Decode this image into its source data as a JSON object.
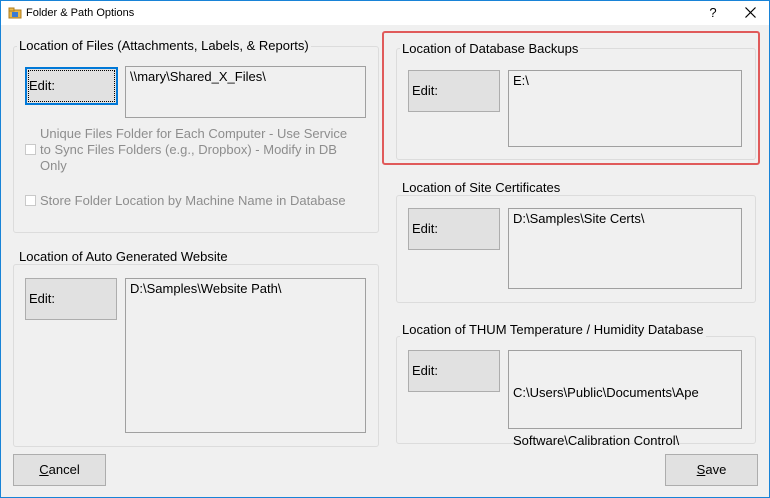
{
  "window": {
    "title": "Folder & Path Options",
    "help_label": "?"
  },
  "files_group": {
    "title": "Location of Files (Attachments, Labels, & Reports)",
    "edit_label": "Edit:",
    "path": "\\\\mary\\Shared_X_Files\\",
    "unique_folder_label_lines": [
      "Unique Files Folder for Each Computer - Use Service",
      "to Sync Files Folders (e.g., Dropbox) - Modify in DB",
      "Only"
    ],
    "store_by_machine_label": "Store Folder Location by Machine Name in Database"
  },
  "website_group": {
    "title": "Location of Auto Generated Website",
    "edit_label": "Edit:",
    "path": "D:\\Samples\\Website Path\\"
  },
  "backups_group": {
    "title": "Location of Database Backups",
    "edit_label": "Edit:",
    "path": "E:\\"
  },
  "certs_group": {
    "title": "Location of Site Certificates",
    "edit_label": "Edit:",
    "path": "D:\\Samples\\Site Certs\\"
  },
  "thum_group": {
    "title": "Location of THUM Temperature / Humidity Database",
    "edit_label": "Edit:",
    "path_lines": [
      "C:\\Users\\Public\\Documents\\Ape",
      "Software\\Calibration Control\\"
    ]
  },
  "footer": {
    "cancel_label": "Cancel",
    "save_label": "Save"
  },
  "colors": {
    "highlight": "#e05a5a",
    "focus": "#0078d7"
  }
}
